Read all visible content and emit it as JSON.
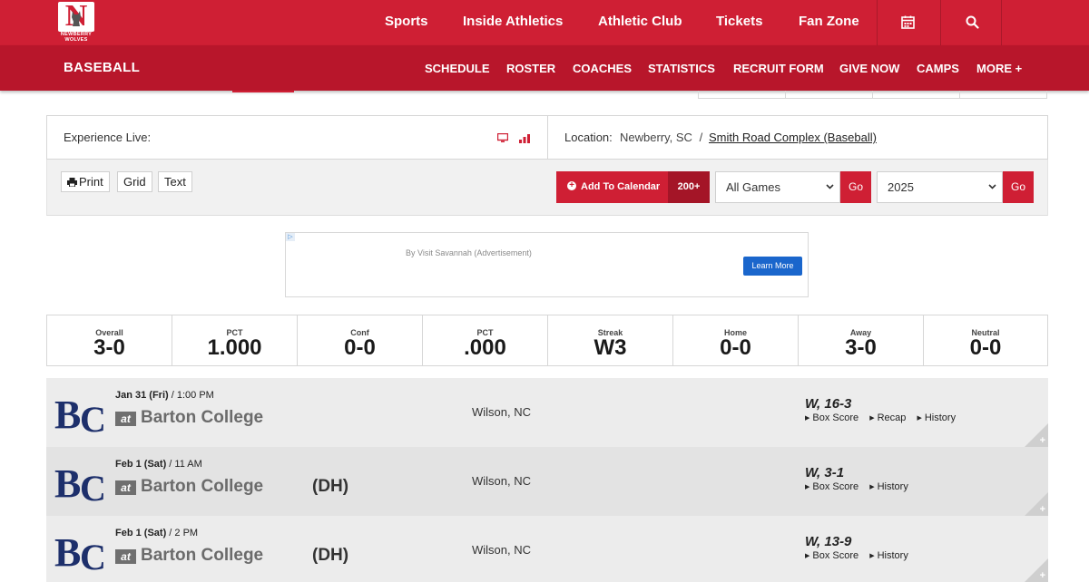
{
  "brand": {
    "logo_letter": "N",
    "logo_text": "NEWBERRY WOLVES",
    "primary_color": "#cf1f34",
    "secondary_color": "#b8162b"
  },
  "nav": {
    "items": [
      "Sports",
      "Inside Athletics",
      "Athletic Club",
      "Tickets",
      "Fan Zone"
    ],
    "calendar_icon": "calendar-icon",
    "search_icon": "search-icon"
  },
  "subnav": {
    "title": "BASEBALL",
    "items": [
      "SCHEDULE",
      "ROSTER",
      "COACHES",
      "STATISTICS",
      "RECRUIT FORM",
      "GIVE NOW",
      "CAMPS",
      "MORE +"
    ]
  },
  "experience": {
    "label": "Experience Live:",
    "location_label": "Location:",
    "location_city": "Newberry, SC",
    "separator": "/",
    "venue": "Smith Road Complex (Baseball)"
  },
  "toolbar": {
    "print": "Print",
    "grid": "Grid",
    "text": "Text",
    "add_calendar": "Add To Calendar",
    "calendar_count": "200+",
    "games_filter": "All Games",
    "season": "2025",
    "go": "Go"
  },
  "ad": {
    "text": "By Visit Savannah (Advertisement)",
    "button": "Learn More",
    "mark": "▷"
  },
  "record": [
    {
      "label": "Overall",
      "value": "3-0"
    },
    {
      "label": "PCT",
      "value": "1.000"
    },
    {
      "label": "Conf",
      "value": "0-0"
    },
    {
      "label": "PCT",
      "value": ".000"
    },
    {
      "label": "Streak",
      "value": "W3"
    },
    {
      "label": "Home",
      "value": "0-0"
    },
    {
      "label": "Away",
      "value": "3-0"
    },
    {
      "label": "Neutral",
      "value": "0-0"
    }
  ],
  "games": [
    {
      "date": "Jan 31 (Fri)",
      "time": " / 1:00 PM",
      "at": "at",
      "opponent": "Barton College",
      "dh": "",
      "location": "Wilson, NC",
      "result": "W, 16-3",
      "links": [
        "Box Score",
        "Recap",
        "History"
      ]
    },
    {
      "date": "Feb 1 (Sat)",
      "time": " / 11 AM",
      "at": "at",
      "opponent": "Barton College",
      "dh": "(DH)",
      "location": "Wilson, NC",
      "result": "W, 3-1",
      "links": [
        "Box Score",
        "History"
      ]
    },
    {
      "date": "Feb 1 (Sat)",
      "time": " / 2 PM",
      "at": "at",
      "opponent": "Barton College",
      "dh": "(DH)",
      "location": "Wilson, NC",
      "result": "W, 13-9",
      "links": [
        "Box Score",
        "History"
      ]
    }
  ]
}
